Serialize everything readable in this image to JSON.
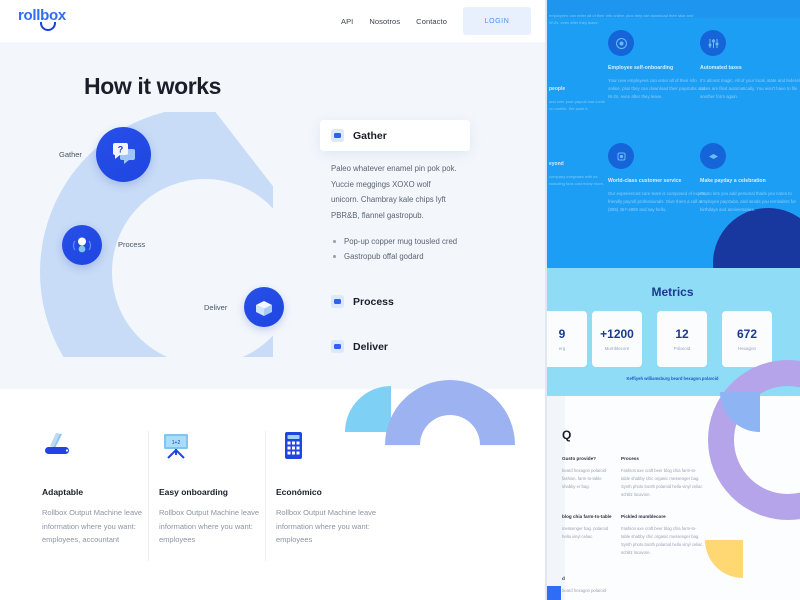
{
  "header": {
    "logo_text": "rollbox",
    "nav": [
      {
        "label": "API"
      },
      {
        "label": "Nosotros"
      },
      {
        "label": "Contacto"
      }
    ],
    "login_label": "LOGIN"
  },
  "hero": {
    "title": "How it works",
    "diagram": {
      "nodes": [
        {
          "label": "Gather",
          "icon": "chat-question-icon"
        },
        {
          "label": "Process",
          "icon": "people-icon"
        },
        {
          "label": "Deliver",
          "icon": "open-box-icon"
        }
      ]
    },
    "accordion": {
      "items": [
        {
          "label": "Gather",
          "open": true
        },
        {
          "label": "Process",
          "open": false
        },
        {
          "label": "Deliver",
          "open": false
        }
      ],
      "open_body": {
        "paragraph": "Paleo whatever enamel pin pok pok. Yuccie meggings XOXO wolf unicorn. Chambray kale chips lyft PBR&B, flannel gastropub.",
        "bullets": [
          "Pop-up copper mug tousled cred",
          "Gastropub offal godard"
        ]
      }
    }
  },
  "features": [
    {
      "icon": "swiss-knife-icon",
      "name": "Adaptable",
      "desc": "Rollbox Output Machine leave information where you want: employees, accountant"
    },
    {
      "icon": "blackboard-icon",
      "name": "Easy onboarding",
      "desc": "Rollbox Output Machine leave information where you want: employees"
    },
    {
      "icon": "calculator-icon",
      "name": "Económico",
      "desc": "Rollbox Output Machine leave information where you want: employees"
    }
  ],
  "right_panel": {
    "blue_section": {
      "top_text": "employees can enter all of their info online, plus they can download their stub and W-2s, even after they leave.",
      "edge_items": [
        {
          "title": "people",
          "body": "and over your payroll and come on mobile. We push it."
        },
        {
          "title": "eyond",
          "body": "company integrates with es including foos cost many more."
        }
      ],
      "cells": [
        {
          "icon": "target-icon",
          "title": "Employee self-onboarding",
          "body": "Your new employees can enter all of their info online, plus they can download their paystubs and W-2s, even after they leave."
        },
        {
          "icon": "sliders-icon",
          "title": "Automated taxes",
          "body": "It's almost magic. All of your local, state and federal taxes are filed automatically. You won't have to file another form again."
        },
        {
          "icon": "support-icon",
          "title": "World-class customer service",
          "body": "Our experienced care team is composed of expert, friendly payroll professionals. Give them a call at (855) 457-4890 and say hello."
        },
        {
          "icon": "gift-icon",
          "title": "Make payday a celebration",
          "body": "Gusto lets you add personal thank you notes to employee paystubs, and sends you reminders for birthdays and anniversaries."
        }
      ]
    },
    "metrics": {
      "title": "Metrics",
      "caption": "Keffiyeh williamsburg beard hexagon polaroid",
      "cards": [
        {
          "value": "9",
          "label": "erg"
        },
        {
          "value": "+1200",
          "label": "Mumblecore"
        },
        {
          "value": "12",
          "label": "Polaroid"
        },
        {
          "value": "672",
          "label": "Hexagon"
        }
      ]
    },
    "faq": {
      "mark": "Q",
      "entries": [
        {
          "question": "Gusto provide?",
          "answer": "beard hexagon polaroid fashion. farm-to-table shabby er bag."
        },
        {
          "question": "Process",
          "answer": "Fashion axe craft beer blog chia farm-to-table shabby chic organic messenger bag. Synth photo booth polaroid hella vinyl celiac schlitz locavore."
        },
        {
          "question": "blog chia farm-to-table",
          "answer": "messenger bag. polaroid hella vinyl celiac."
        },
        {
          "question": "Pickled mumblecore",
          "answer": "Fashion axe craft beer blog chia farm-to-table shabby chic organic messenger bag. Synth photo booth polaroid hella vinyl celiac schlitz locavore."
        },
        {
          "question": "d",
          "answer": "beard hexagon polaroid"
        }
      ]
    }
  },
  "colors": {
    "brand_blue": "#2f6df6",
    "node_blue": "#2145e3",
    "arc_light": "#c8dcf7",
    "panel_blue": "#1c9ef5",
    "metrics_cyan": "#8fdcf7",
    "deco_purple": "#b5a4ea",
    "deco_yellow": "#ffd874"
  }
}
